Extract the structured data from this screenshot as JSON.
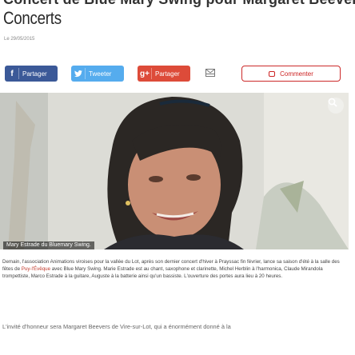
{
  "article": {
    "title_line1": "Concert de Blue Mary Swing pour Margaret Beevers",
    "title_line2": "Concerts",
    "date": "Le 29/05/2015"
  },
  "share": {
    "facebook_label": "Partager",
    "twitter_label": "Tweeter",
    "google_label": "Partager",
    "comment_label": "Commenter"
  },
  "photo": {
    "caption": "Mary Estrade du Bluemary Swing."
  },
  "body": {
    "p1_a": "Demain, l'association Animations viroises pour la vallée du Lot, après son dernier concert d'hiver à Prayssac fin février, lance sa saison d'été à la salle des fêtes de ",
    "p1_link": "Puy-l'Évêque",
    "p1_b": " avec Blue Mary Swing. Marie Estrade est au chant, saxophone et clarinette, Michel Herblin à l'harmonica, Claude Mirandola trompettiste, Marco Estrade à la guitare, Auguste à la batterie ainsi qu'un bassiste. L'ouverture des portes aura lieu à 20 heures.",
    "lead": "L'invité d'honneur sera Margaret Beevers de Vire-sur-Lot, qui a énormément donné à la"
  },
  "colors": {
    "facebook": "#3b5998",
    "twitter": "#55acee",
    "google": "#dd4b39",
    "comment_accent": "#cc2a2a",
    "link": "#c0392b"
  }
}
